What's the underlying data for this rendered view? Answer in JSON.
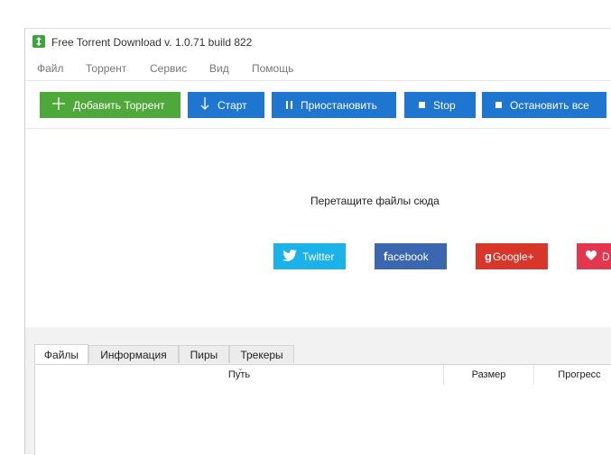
{
  "window": {
    "title": "Free Torrent Download v. 1.0.71 build 822"
  },
  "menu": {
    "items": [
      "Файл",
      "Торрент",
      "Сервис",
      "Вид",
      "Помощь"
    ]
  },
  "toolbar": {
    "add_label": "Добавить Торрент",
    "start_label": "Старт",
    "pause_label": "Приостановить",
    "stop_label": "Stop",
    "stop_all_label": "Остановить все"
  },
  "drop_zone": {
    "text": "Перетащите файлы сюда"
  },
  "social": {
    "twitter_label": "Twitter",
    "facebook_label": "acebook",
    "facebook_glyph": "f",
    "google_label": "Google+",
    "google_glyph": "g",
    "more_glyph": "D"
  },
  "tabs": [
    "Файлы",
    "Информация",
    "Пиры",
    "Трекеры"
  ],
  "columns": {
    "path": "Путь",
    "size": "Размер",
    "progress": "Прогресс"
  },
  "colors": {
    "add_button": "#4fa83a",
    "action_buttons": "#1f76d0",
    "twitter": "#1ab2e8",
    "facebook": "#3b66b0",
    "google": "#d8352b",
    "more": "#e2374e"
  },
  "icons": {
    "app": "app-logo-icon",
    "add": "plus-icon",
    "start": "arrow-down-icon",
    "pause": "pause-icon",
    "stop": "stop-square-icon",
    "stop_all": "stop-square-icon",
    "twitter": "twitter-bird-icon",
    "facebook": "facebook-icon",
    "google": "google-plus-icon",
    "more": "heart-icon"
  }
}
